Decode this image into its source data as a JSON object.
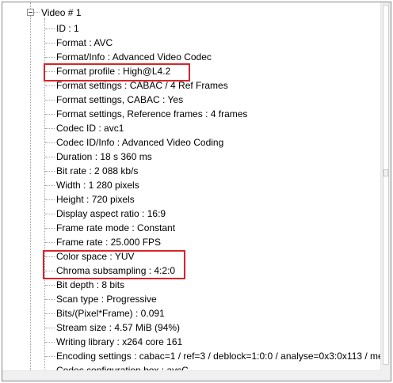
{
  "tree": {
    "root_label": "Video # 1",
    "items": [
      "ID : 1",
      "Format : AVC",
      "Format/Info : Advanced Video Codec",
      "Format profile : High@L4.2",
      "Format settings : CABAC / 4 Ref Frames",
      "Format settings, CABAC : Yes",
      "Format settings, Reference frames : 4 frames",
      "Codec ID : avc1",
      "Codec ID/Info : Advanced Video Coding",
      "Duration : 18 s 360 ms",
      "Bit rate : 2 088 kb/s",
      "Width : 1 280 pixels",
      "Height : 720 pixels",
      "Display aspect ratio : 16:9",
      "Frame rate mode : Constant",
      "Frame rate : 25.000 FPS",
      "Color space : YUV",
      "Chroma subsampling : 4:2:0",
      "Bit depth : 8 bits",
      "Scan type : Progressive",
      "Bits/(Pixel*Frame) : 0.091",
      "Stream size : 4.57 MiB (94%)",
      "Writing library : x264 core 161",
      "Encoding settings : cabac=1 / ref=3 / deblock=1:0:0 / analyse=0x3:0x113 / me",
      "Codec configuration box : avcC"
    ]
  },
  "colors": {
    "highlight": "#d9232b",
    "tree_lines": "#a0a0a0",
    "border": "#828790"
  },
  "icons": {
    "expander": "collapse-minus-icon"
  }
}
